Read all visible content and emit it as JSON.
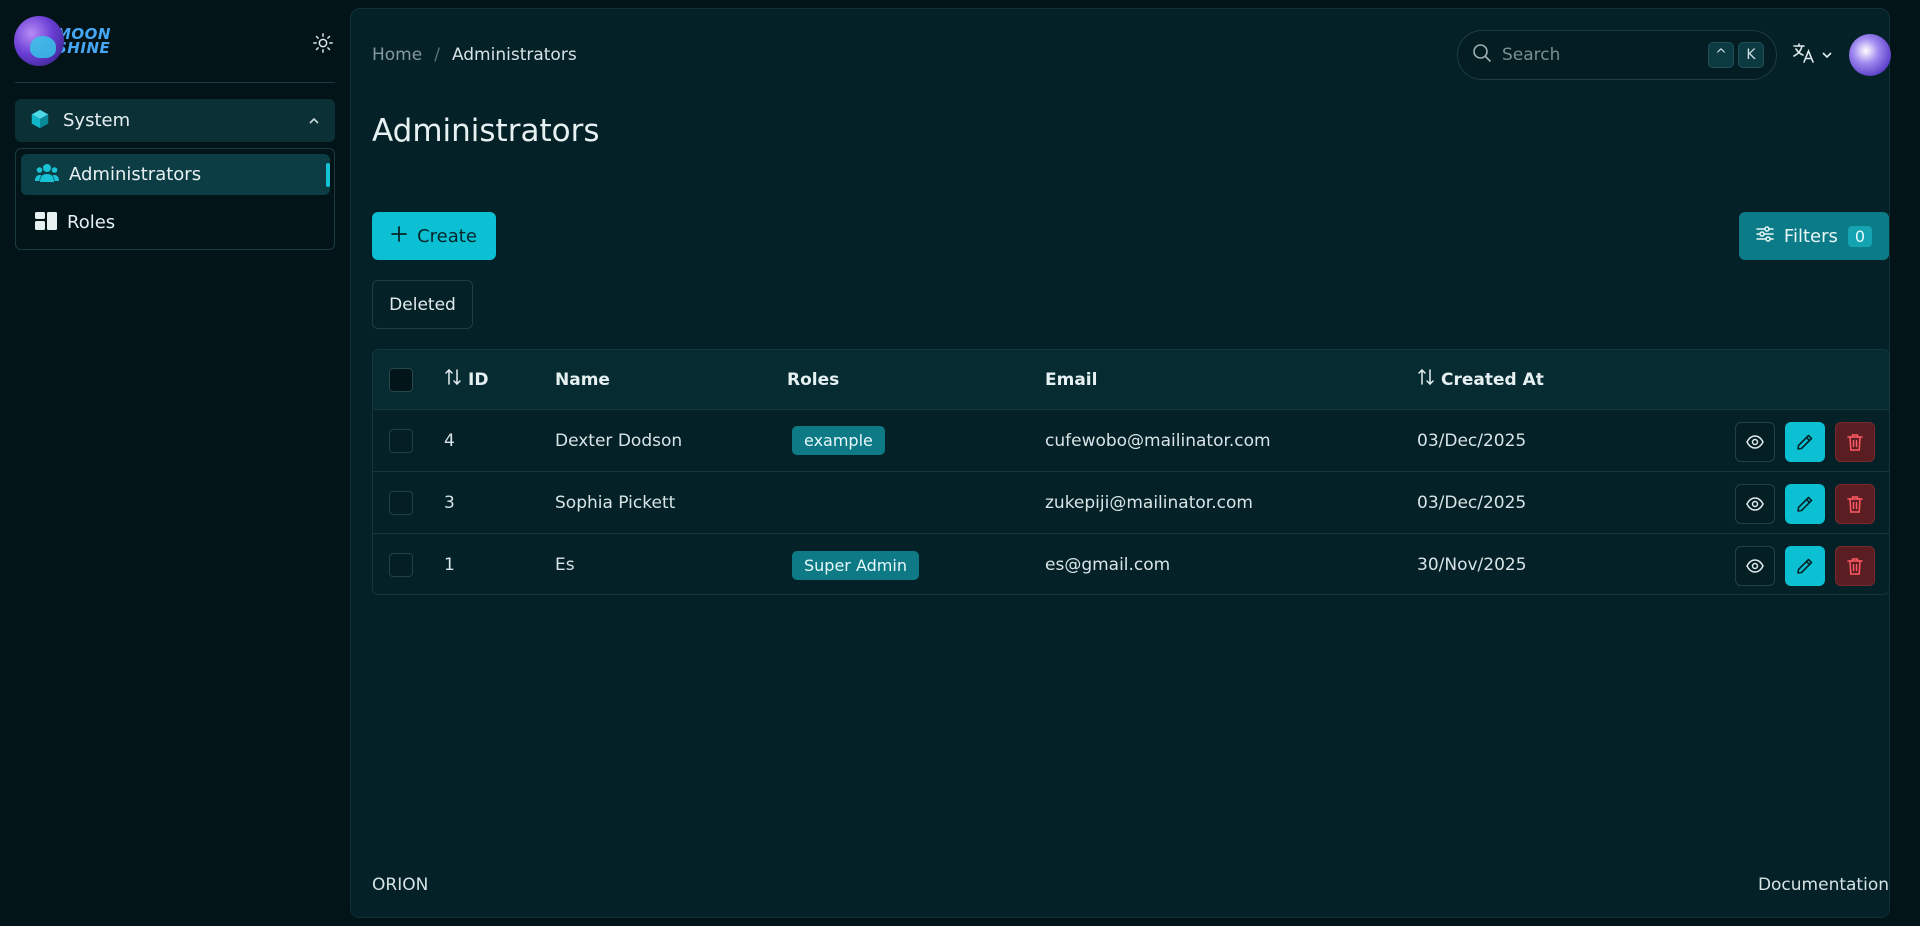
{
  "app": {
    "logo_line1": "MOON",
    "logo_line2": "SHINE",
    "accent_color": "#0ac0d2"
  },
  "sidebar": {
    "group_label": "System",
    "items": [
      {
        "label": "Administrators",
        "icon": "users-icon",
        "active": true
      },
      {
        "label": "Roles",
        "icon": "grid-icon",
        "active": false
      }
    ]
  },
  "header": {
    "breadcrumb": {
      "home": "Home",
      "separator": "/",
      "current": "Administrators"
    },
    "search": {
      "placeholder": "Search",
      "shortcut_key1": "^",
      "shortcut_key2": "K"
    }
  },
  "page": {
    "title": "Administrators",
    "create_label": "Create",
    "filters_label": "Filters",
    "filters_count": "0",
    "deleted_label": "Deleted"
  },
  "table": {
    "columns": [
      "ID",
      "Name",
      "Roles",
      "Email",
      "Created At"
    ],
    "rows": [
      {
        "id": "4",
        "name": "Dexter Dodson",
        "role": "example",
        "email": "cufewobo@mailinator.com",
        "created": "03/Dec/2025"
      },
      {
        "id": "3",
        "name": "Sophia Pickett",
        "role": "",
        "email": "zukepiji@mailinator.com",
        "created": "03/Dec/2025"
      },
      {
        "id": "1",
        "name": "Es",
        "role": "Super Admin",
        "email": "es@gmail.com",
        "created": "30/Nov/2025"
      }
    ]
  },
  "footer": {
    "left": "ORION",
    "right": "Documentation"
  }
}
